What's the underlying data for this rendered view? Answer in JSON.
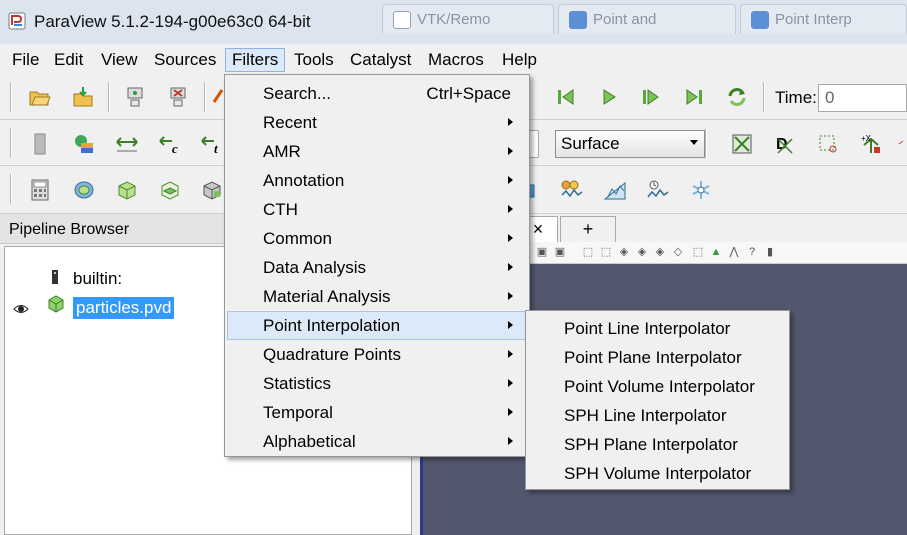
{
  "window": {
    "title": "ParaView 5.1.2-194-g00e63c0 64-bit",
    "background_tabs": [
      "VTK/Remo",
      "Point and",
      "Point Interp"
    ]
  },
  "menubar": {
    "items": [
      "File",
      "Edit",
      "View",
      "Sources",
      "Filters",
      "Tools",
      "Catalyst",
      "Macros",
      "Help"
    ],
    "active": "Filters"
  },
  "toolbar": {
    "time_label": "Time:",
    "time_value": "0",
    "representation": "Surface"
  },
  "pipeline_browser": {
    "title": "Pipeline Browser",
    "items": [
      {
        "label": "builtin:"
      },
      {
        "label": "particles.pvd",
        "selected": true,
        "visible": true
      }
    ]
  },
  "view_tabs": {
    "close_label": "×",
    "add_label": "+"
  },
  "filters_menu": {
    "items": [
      {
        "label": "Search...",
        "shortcut": "Ctrl+Space",
        "submenu": false
      },
      {
        "label": "Recent",
        "submenu": true
      },
      {
        "label": "AMR",
        "submenu": true
      },
      {
        "label": "Annotation",
        "submenu": true
      },
      {
        "label": "CTH",
        "submenu": true
      },
      {
        "label": "Common",
        "submenu": true
      },
      {
        "label": "Data Analysis",
        "submenu": true
      },
      {
        "label": "Material Analysis",
        "submenu": true
      },
      {
        "label": "Point Interpolation",
        "submenu": true,
        "active": true
      },
      {
        "label": "Quadrature Points",
        "submenu": true
      },
      {
        "label": "Statistics",
        "submenu": true
      },
      {
        "label": "Temporal",
        "submenu": true
      },
      {
        "label": "Alphabetical",
        "submenu": true
      }
    ]
  },
  "point_interpolation_menu": {
    "items": [
      "Point Line Interpolator",
      "Point Plane Interpolator",
      "Point Volume Interpolator",
      "SPH Line Interpolator",
      "SPH Plane Interpolator",
      "SPH Volume Interpolator"
    ]
  },
  "colors": {
    "render_background": "#52576e",
    "selection": "#3399ff",
    "menu_highlight": "#dce9f8"
  }
}
